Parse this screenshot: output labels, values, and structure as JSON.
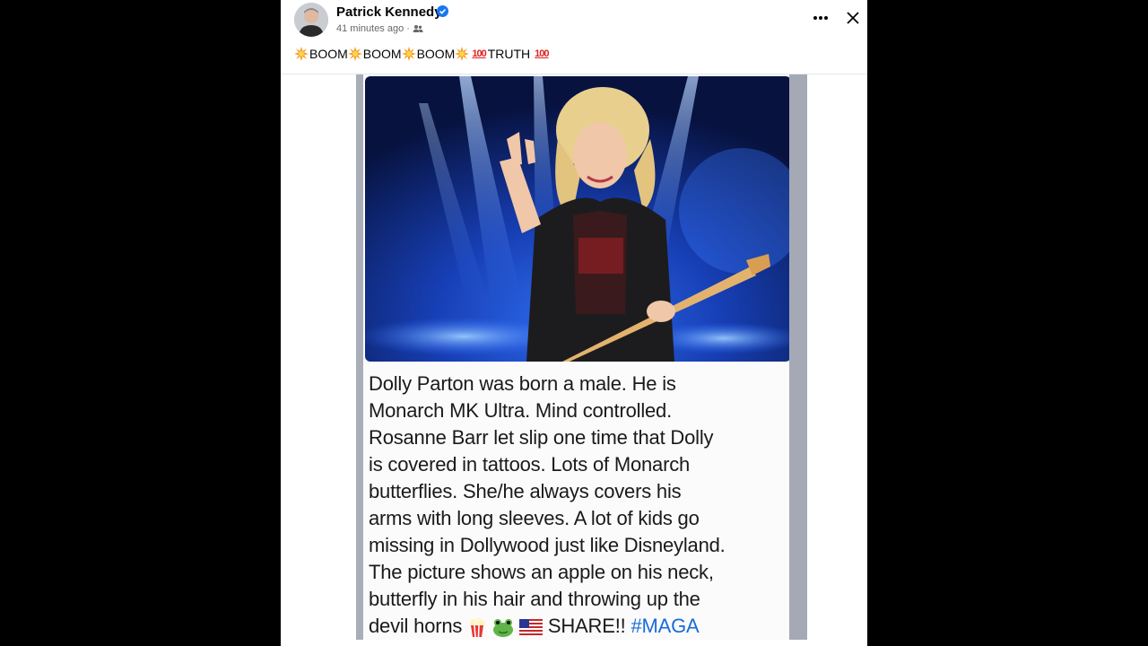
{
  "post": {
    "author_name": "Patrick Kennedy",
    "timestamp": "41 minutes ago",
    "separator": "·",
    "caption": {
      "word": "BOOM",
      "truth_word": "TRUTH",
      "badge_100": "100"
    }
  },
  "icons": {
    "verified": "verified-badge-icon",
    "audience": "friends-audience-icon",
    "more": "more-options-icon",
    "close": "close-icon",
    "boom": "collision-emoji-icon",
    "hundred": "hundred-points-emoji-icon",
    "popcorn": "popcorn-emoji-icon",
    "frog": "frog-emoji-icon",
    "flag": "us-flag-emoji-icon"
  },
  "meme": {
    "lines": [
      "Dolly Parton was born a male. He is",
      "Monarch MK Ultra. Mind controlled.",
      "Rosanne Barr let slip one time that Dolly",
      "is covered in tattoos.  Lots of Monarch",
      "butterflies. She/he always covers his",
      "arms with long sleeves.  A lot of kids go",
      "missing in Dollywood just like Disneyland.",
      "The picture shows an apple on his neck,",
      "butterfly in his hair and throwing up the"
    ],
    "last_line_start": "devil horns",
    "share_text": "SHARE!!",
    "hashtag": "#MAGA"
  },
  "colors": {
    "accent_blue": "#1877f2",
    "hashtag_blue": "#1a6bd8",
    "stage_blue": "#1b46c8"
  }
}
